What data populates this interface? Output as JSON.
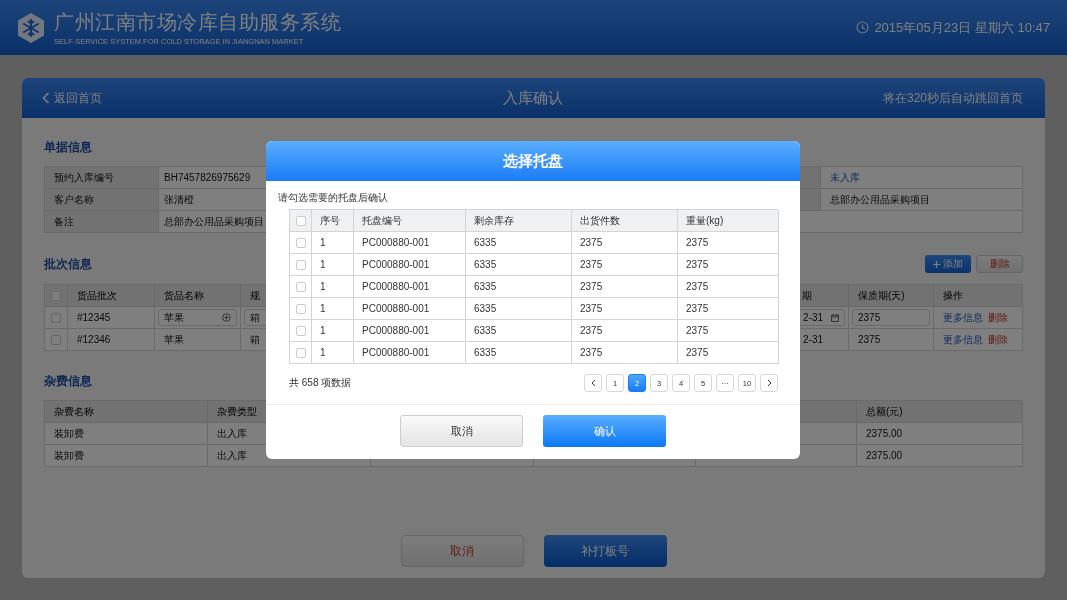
{
  "header": {
    "title": "广州江南市场冷库自助服务系统",
    "subtitle": "SELF-SERVICE SYSTEM FOR COLD STORAGE IN JIANGNAN MARKET",
    "datetime": "2015年05月23日 星期六 10:47"
  },
  "page": {
    "back": "返回首页",
    "title": "入库确认",
    "countdown": "将在320秒后自动跳回首页"
  },
  "document_info": {
    "heading": "单据信息",
    "rows": [
      {
        "kind": "split",
        "label": "预约入库编号",
        "value": "BH7457826975629",
        "right_value": "未入库",
        "right_link": true
      },
      {
        "kind": "split",
        "label": "客户名称",
        "value": "张清橙",
        "right_value": "总部办公用品采购项目",
        "right_link": false
      },
      {
        "kind": "wide",
        "label": "备注",
        "value": "总部办公用品采购项目"
      }
    ]
  },
  "batch_info": {
    "heading": "批次信息",
    "add_button": "添加",
    "delete_button": "删除",
    "header_checked": false,
    "columns": [
      "货品批次",
      "货品名称",
      "规"
    ],
    "right_columns": [
      "期",
      "保质期(天)",
      "操作"
    ],
    "rows": [
      {
        "checked": false,
        "editing": true,
        "batch": "#12345",
        "name": "苹果",
        "spec": "箱",
        "date": "2-31",
        "shelf_life": "2375",
        "actions": [
          "更多信息",
          "删除"
        ]
      },
      {
        "checked": false,
        "editing": false,
        "batch": "#12346",
        "name": "苹果",
        "spec": "箱",
        "date": "2-31",
        "shelf_life": "2375",
        "actions": [
          "更多信息",
          "删除"
        ]
      }
    ]
  },
  "fee_info": {
    "heading": "杂费信息",
    "columns": [
      "杂费名称",
      "杂费类型"
    ],
    "right_column": "总额(元)",
    "rows": [
      {
        "name": "装卸费",
        "type": "出入库",
        "total": "2375.00"
      },
      {
        "name": "装卸费",
        "type": "出入库",
        "total": "2375.00"
      }
    ]
  },
  "footer_buttons": [
    {
      "label": "取消",
      "kind": "secondary"
    },
    {
      "label": "补打板号",
      "kind": "primary"
    }
  ],
  "modal": {
    "title": "选择托盘",
    "hint": "请勾选需要的托盘后确认",
    "header_checked": false,
    "columns": [
      "序号",
      "托盘编号",
      "剩余库存",
      "出货件数",
      "重量(kg)"
    ],
    "rows": [
      {
        "checked": false,
        "cells": [
          "1",
          "PC000880-001",
          "6335",
          "2375",
          "2375"
        ]
      },
      {
        "checked": false,
        "cells": [
          "1",
          "PC000880-001",
          "6335",
          "2375",
          "2375"
        ]
      },
      {
        "checked": false,
        "cells": [
          "1",
          "PC000880-001",
          "6335",
          "2375",
          "2375"
        ]
      },
      {
        "checked": false,
        "cells": [
          "1",
          "PC000880-001",
          "6335",
          "2375",
          "2375"
        ]
      },
      {
        "checked": false,
        "cells": [
          "1",
          "PC000880-001",
          "6335",
          "2375",
          "2375"
        ]
      },
      {
        "checked": false,
        "cells": [
          "1",
          "PC000880-001",
          "6335",
          "2375",
          "2375"
        ]
      }
    ],
    "total": "共 658 项数据",
    "pages": [
      {
        "kind": "prev"
      },
      {
        "kind": "page",
        "label": "1",
        "selected": false
      },
      {
        "kind": "page",
        "label": "2",
        "selected": true
      },
      {
        "kind": "page",
        "label": "3",
        "selected": false
      },
      {
        "kind": "page",
        "label": "4",
        "selected": false
      },
      {
        "kind": "page",
        "label": "5",
        "selected": false
      },
      {
        "kind": "page",
        "label": "···",
        "selected": false
      },
      {
        "kind": "page",
        "label": "10",
        "selected": false
      },
      {
        "kind": "next"
      }
    ],
    "buttons": [
      {
        "label": "取消",
        "kind": "secondary"
      },
      {
        "label": "确认",
        "kind": "primary"
      }
    ]
  }
}
